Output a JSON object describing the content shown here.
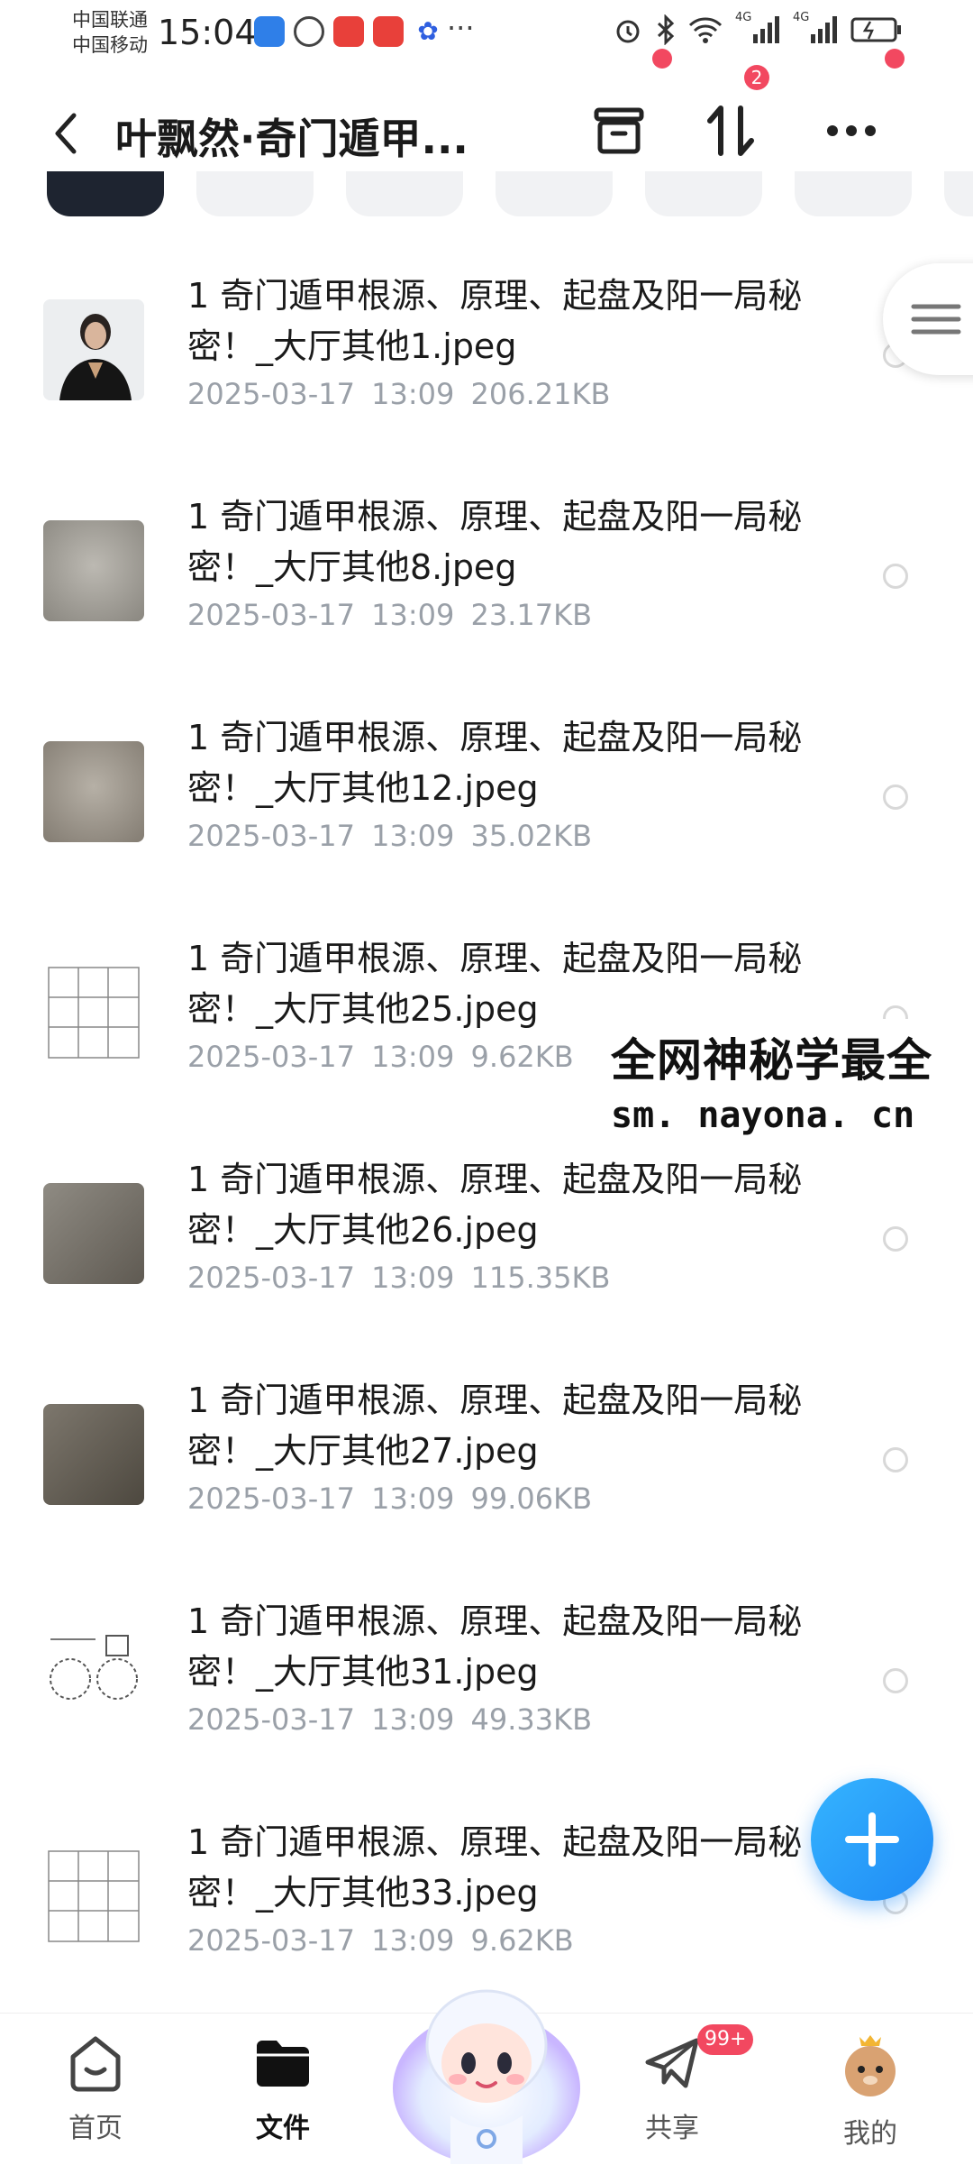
{
  "status_bar": {
    "carrier1": "中国联通",
    "carrier2": "中国移动",
    "time": "15:04",
    "signal1": "4G",
    "signal2": "4G"
  },
  "header": {
    "title": "叶飘然·奇门遁甲...",
    "transfer_badge": "2"
  },
  "files": [
    {
      "name": "1 奇门遁甲根源、原理、起盘及阳一局秘密！_大厅其他1.jpeg",
      "date": "2025-03-17",
      "time": "13:09",
      "size": "206.21KB"
    },
    {
      "name": "1 奇门遁甲根源、原理、起盘及阳一局秘密！_大厅其他8.jpeg",
      "date": "2025-03-17",
      "time": "13:09",
      "size": "23.17KB"
    },
    {
      "name": "1 奇门遁甲根源、原理、起盘及阳一局秘密！_大厅其他12.jpeg",
      "date": "2025-03-17",
      "time": "13:09",
      "size": "35.02KB"
    },
    {
      "name": "1 奇门遁甲根源、原理、起盘及阳一局秘密！_大厅其他25.jpeg",
      "date": "2025-03-17",
      "time": "13:09",
      "size": "9.62KB"
    },
    {
      "name": "1 奇门遁甲根源、原理、起盘及阳一局秘密！_大厅其他26.jpeg",
      "date": "2025-03-17",
      "time": "13:09",
      "size": "115.35KB"
    },
    {
      "name": "1 奇门遁甲根源、原理、起盘及阳一局秘密！_大厅其他27.jpeg",
      "date": "2025-03-17",
      "time": "13:09",
      "size": "99.06KB"
    },
    {
      "name": "1 奇门遁甲根源、原理、起盘及阳一局秘密！_大厅其他31.jpeg",
      "date": "2025-03-17",
      "time": "13:09",
      "size": "49.33KB"
    },
    {
      "name": "1 奇门遁甲根源、原理、起盘及阳一局秘密！_大厅其他33.jpeg",
      "date": "2025-03-17",
      "time": "13:09",
      "size": "9.62KB"
    }
  ],
  "watermark": {
    "line1": "全网神秘学最全",
    "line2": "sm. nayona. cn"
  },
  "bottom_nav": {
    "home": "首页",
    "files": "文件",
    "share": "共享",
    "share_badge": "99+",
    "mine": "我的"
  },
  "colors": {
    "accent": "#1f8af5",
    "badge": "#f24860",
    "meta_text": "#9aa0a8"
  }
}
